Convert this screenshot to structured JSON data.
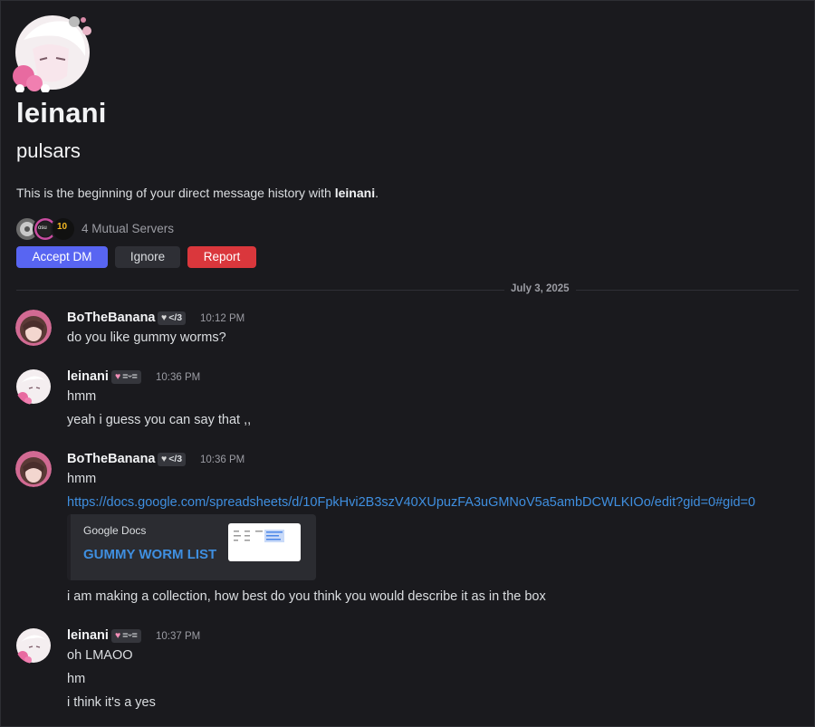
{
  "profile": {
    "display_name": "leinani",
    "username": "pulsars",
    "intro_prefix": "This is the beginning of your direct message history with ",
    "intro_name": "leinani",
    "intro_suffix": ".",
    "mutual_servers": "4 Mutual Servers",
    "server_icon_labels": [
      "osu",
      "10"
    ]
  },
  "actions": {
    "accept": "Accept DM",
    "ignore": "Ignore",
    "report": "Report"
  },
  "date_divider": "July 3, 2025",
  "messages": [
    {
      "author": "BoTheBanana",
      "tag": "</3",
      "time": "10:12 PM",
      "lines": [
        "do you like gummy worms?"
      ]
    },
    {
      "author": "leinani",
      "tag": "=ᵕ=",
      "time": "10:36 PM",
      "lines": [
        "hmm",
        "yeah i guess you can say that ,,"
      ]
    },
    {
      "author": "BoTheBanana",
      "tag": "</3",
      "time": "10:36 PM",
      "lines": [
        "hmm"
      ],
      "link": "https://docs.google.com/spreadsheets/d/10FpkHvi2B3szV40XUpuzFA3uGMNoV5a5ambDCWLKIOo/edit?gid=0#gid=0",
      "embed": {
        "provider": "Google Docs",
        "title": "GUMMY WORM LIST"
      },
      "after": "i am making a collection, how best do you think you would describe it as in the box"
    },
    {
      "author": "leinani",
      "tag": "=ᵕ=",
      "time": "10:37 PM",
      "lines": [
        "oh LMAOO",
        "hm",
        "i think it's a yes"
      ]
    }
  ],
  "colors": {
    "background": "#1a1a1e",
    "accept": "#5865f2",
    "report": "#da373c",
    "link": "#3f8fe0"
  }
}
